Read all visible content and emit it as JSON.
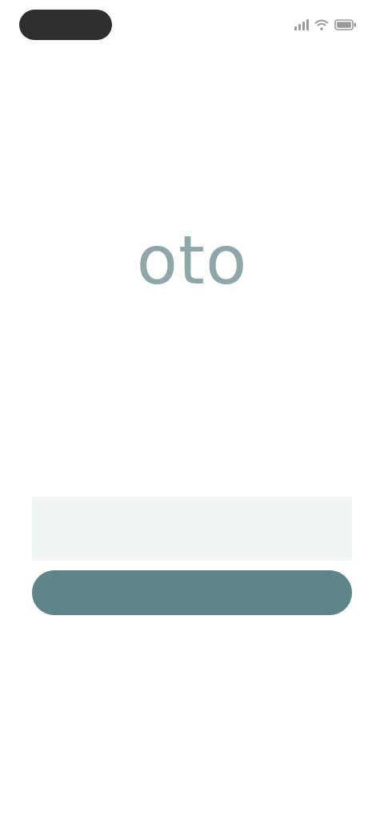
{
  "status_bar": {
    "time": "",
    "signal_icon": "signal-bars-icon",
    "wifi_icon": "wifi-icon",
    "battery_icon": "battery-icon"
  },
  "brand": {
    "logo_text": "oto",
    "logo_color": "#8fa7a9"
  },
  "login": {
    "email_value": "",
    "email_placeholder": "",
    "continue_label": "",
    "accent_color": "#5e8587",
    "field_background": "#f2f5f5"
  }
}
